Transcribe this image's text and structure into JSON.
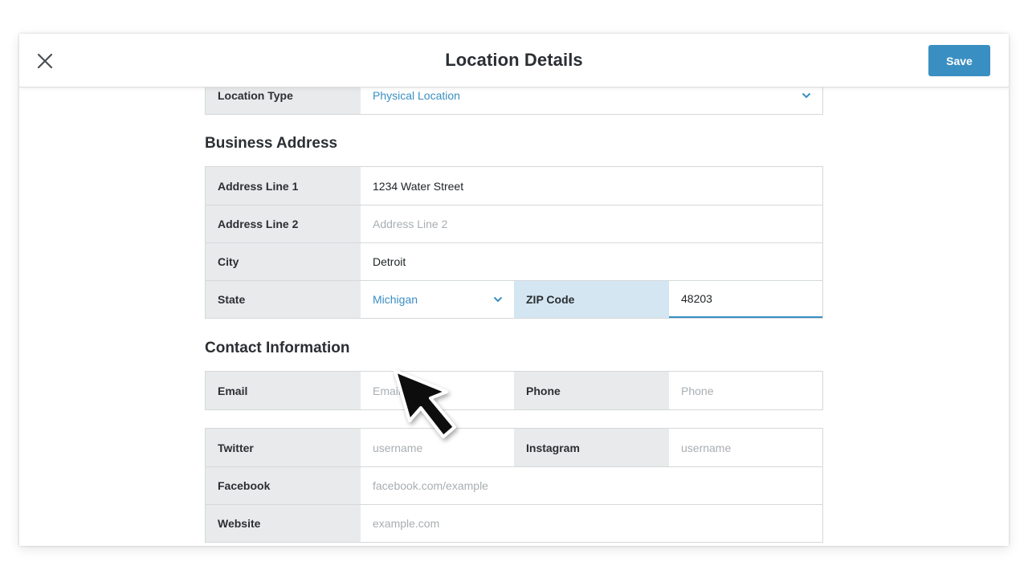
{
  "header": {
    "title": "Location Details",
    "save_label": "Save"
  },
  "location_type": {
    "label": "Location Type",
    "value": "Physical Location"
  },
  "business_address": {
    "section_title": "Business Address",
    "address_line1": {
      "label": "Address Line 1",
      "value": "1234 Water Street"
    },
    "address_line2": {
      "label": "Address Line 2",
      "placeholder": "Address Line 2"
    },
    "city": {
      "label": "City",
      "value": "Detroit"
    },
    "state": {
      "label": "State",
      "value": "Michigan"
    },
    "zip": {
      "label": "ZIP Code",
      "value": "48203"
    }
  },
  "contact_information": {
    "section_title": "Contact Information",
    "email": {
      "label": "Email",
      "placeholder": "Email"
    },
    "phone": {
      "label": "Phone",
      "placeholder": "Phone"
    },
    "twitter": {
      "label": "Twitter",
      "placeholder": "username"
    },
    "instagram": {
      "label": "Instagram",
      "placeholder": "username"
    },
    "facebook": {
      "label": "Facebook",
      "placeholder": "facebook.com/example"
    },
    "website": {
      "label": "Website",
      "placeholder": "example.com"
    }
  },
  "icons": {
    "close": "close-icon",
    "chevron": "chevron-down-icon",
    "cursor": "mouse-pointer-icon"
  },
  "colors": {
    "accent": "#3a8fc2",
    "label_bg": "#e8eaeb",
    "active_label_bg": "#d3e6f1"
  }
}
